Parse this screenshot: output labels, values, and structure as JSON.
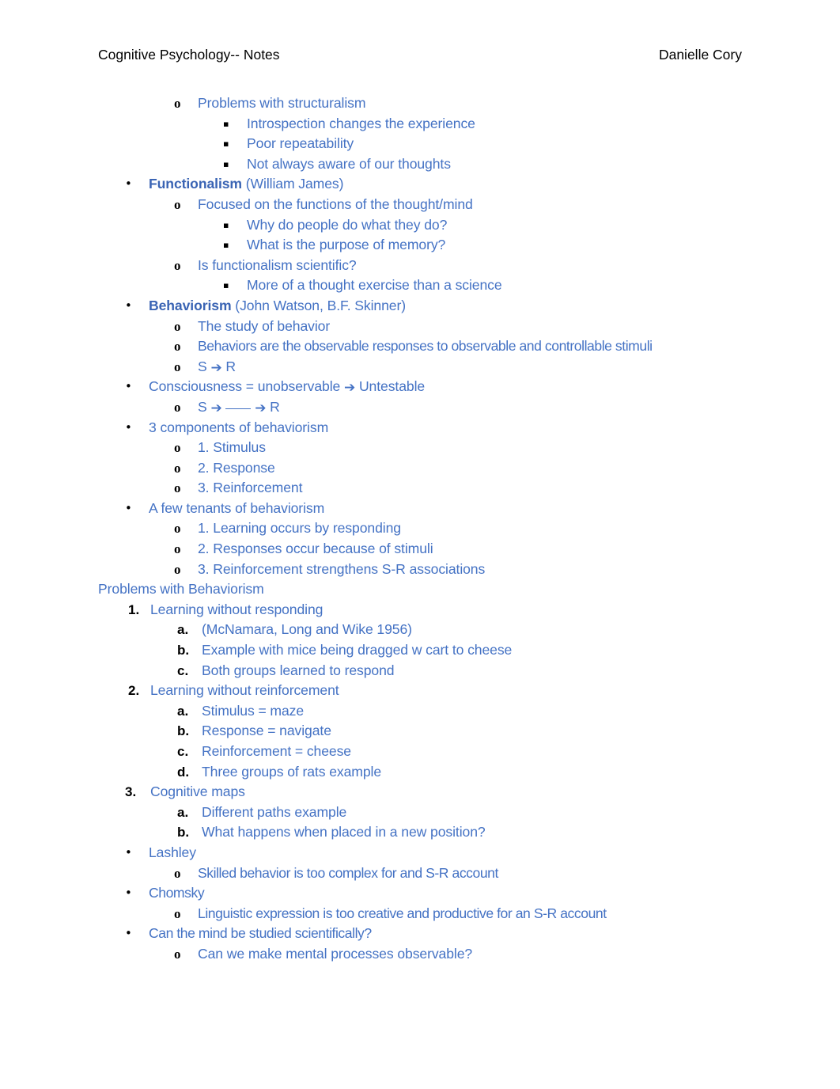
{
  "header": {
    "left": "Cognitive Psychology-- Notes",
    "right": "Danielle Cory"
  },
  "markers": {
    "bullet": "•",
    "circle": "o",
    "square": "▪",
    "n1": "1.",
    "n2": "2.",
    "n3": "3.",
    "a": "a.",
    "b": "b.",
    "c": "c.",
    "d": "d."
  },
  "colors": {
    "body_text": "#4472C4",
    "header_text": "#000000",
    "marker": "#000000",
    "page_background": "#ffffff"
  },
  "lines": {
    "problems_with_structuralism": "Problems with structuralism",
    "introspection_changes": "Introspection changes the experience",
    "poor_repeatability": "Poor repeatability",
    "not_always_aware": "Not always aware of our thoughts",
    "functionalism_bold": "Functionalism",
    "functionalism_rest": " (William James)",
    "focused_on_functions": "Focused on the functions of the thought/mind",
    "why_do_people": "Why do people do what they do?",
    "what_is_purpose": "What is the purpose of memory?",
    "is_functionalism_scientific": "Is functionalism scientific?",
    "more_of_a_thought": "More of a thought exercise than a science",
    "behaviorism_bold": "Behaviorism",
    "behaviorism_rest": " (John Watson, B.F. Skinner)",
    "the_study_of_behavior": "The study of behavior",
    "behaviors_are_observable": "Behaviors are the observable responses to observable and controllable stimuli",
    "s_arrow_r_prefix": "S",
    "s_arrow_r_suffix": "R",
    "consciousness_unobservable_pre": "Consciousness = unobservable",
    "consciousness_unobservable_post": "Untestable",
    "s_blank_r_prefix": "S",
    "s_blank_r_suffix": "R",
    "three_components": "3 components of behaviorism",
    "comp_1_stimulus": "1. Stimulus",
    "comp_2_response": "2. Response",
    "comp_3_reinforcement": "3. Reinforcement",
    "a_few_tenants": "A few tenants of behaviorism",
    "tenant_1": "1. Learning occurs by responding",
    "tenant_2": "2. Responses occur because of stimuli",
    "tenant_3": "3. Reinforcement strengthens S-R associations",
    "problems_with_behaviorism": "Problems with Behaviorism",
    "learning_without_responding": "Learning without responding",
    "mcnamara_citation": "(McNamara, Long and Wike 1956)",
    "example_with_mice": "Example with mice being dragged w cart to cheese",
    "both_groups_learned": "Both groups learned to respond",
    "learning_without_reinforcement": "Learning without reinforcement",
    "stimulus_maze": "Stimulus = maze",
    "response_navigate": "Response = navigate",
    "reinforcement_cheese": "Reinforcement = cheese",
    "three_groups_of_rats": "Three groups of rats example",
    "cognitive_maps": "Cognitive maps",
    "different_paths": "Different paths example",
    "what_happens_new_position": "What happens when placed in a new position?",
    "lashley": "Lashley",
    "skilled_behavior": "Skilled behavior is too complex for and S-R account",
    "chomsky": "Chomsky",
    "linguistic_expression": "Linguistic expression is too creative and productive for an S-R account",
    "can_the_mind_be_studied": "Can the mind be studied scientifically?",
    "can_we_make_mental": "Can we make mental processes observable?"
  },
  "symbols": {
    "arrow_right": "➔"
  }
}
